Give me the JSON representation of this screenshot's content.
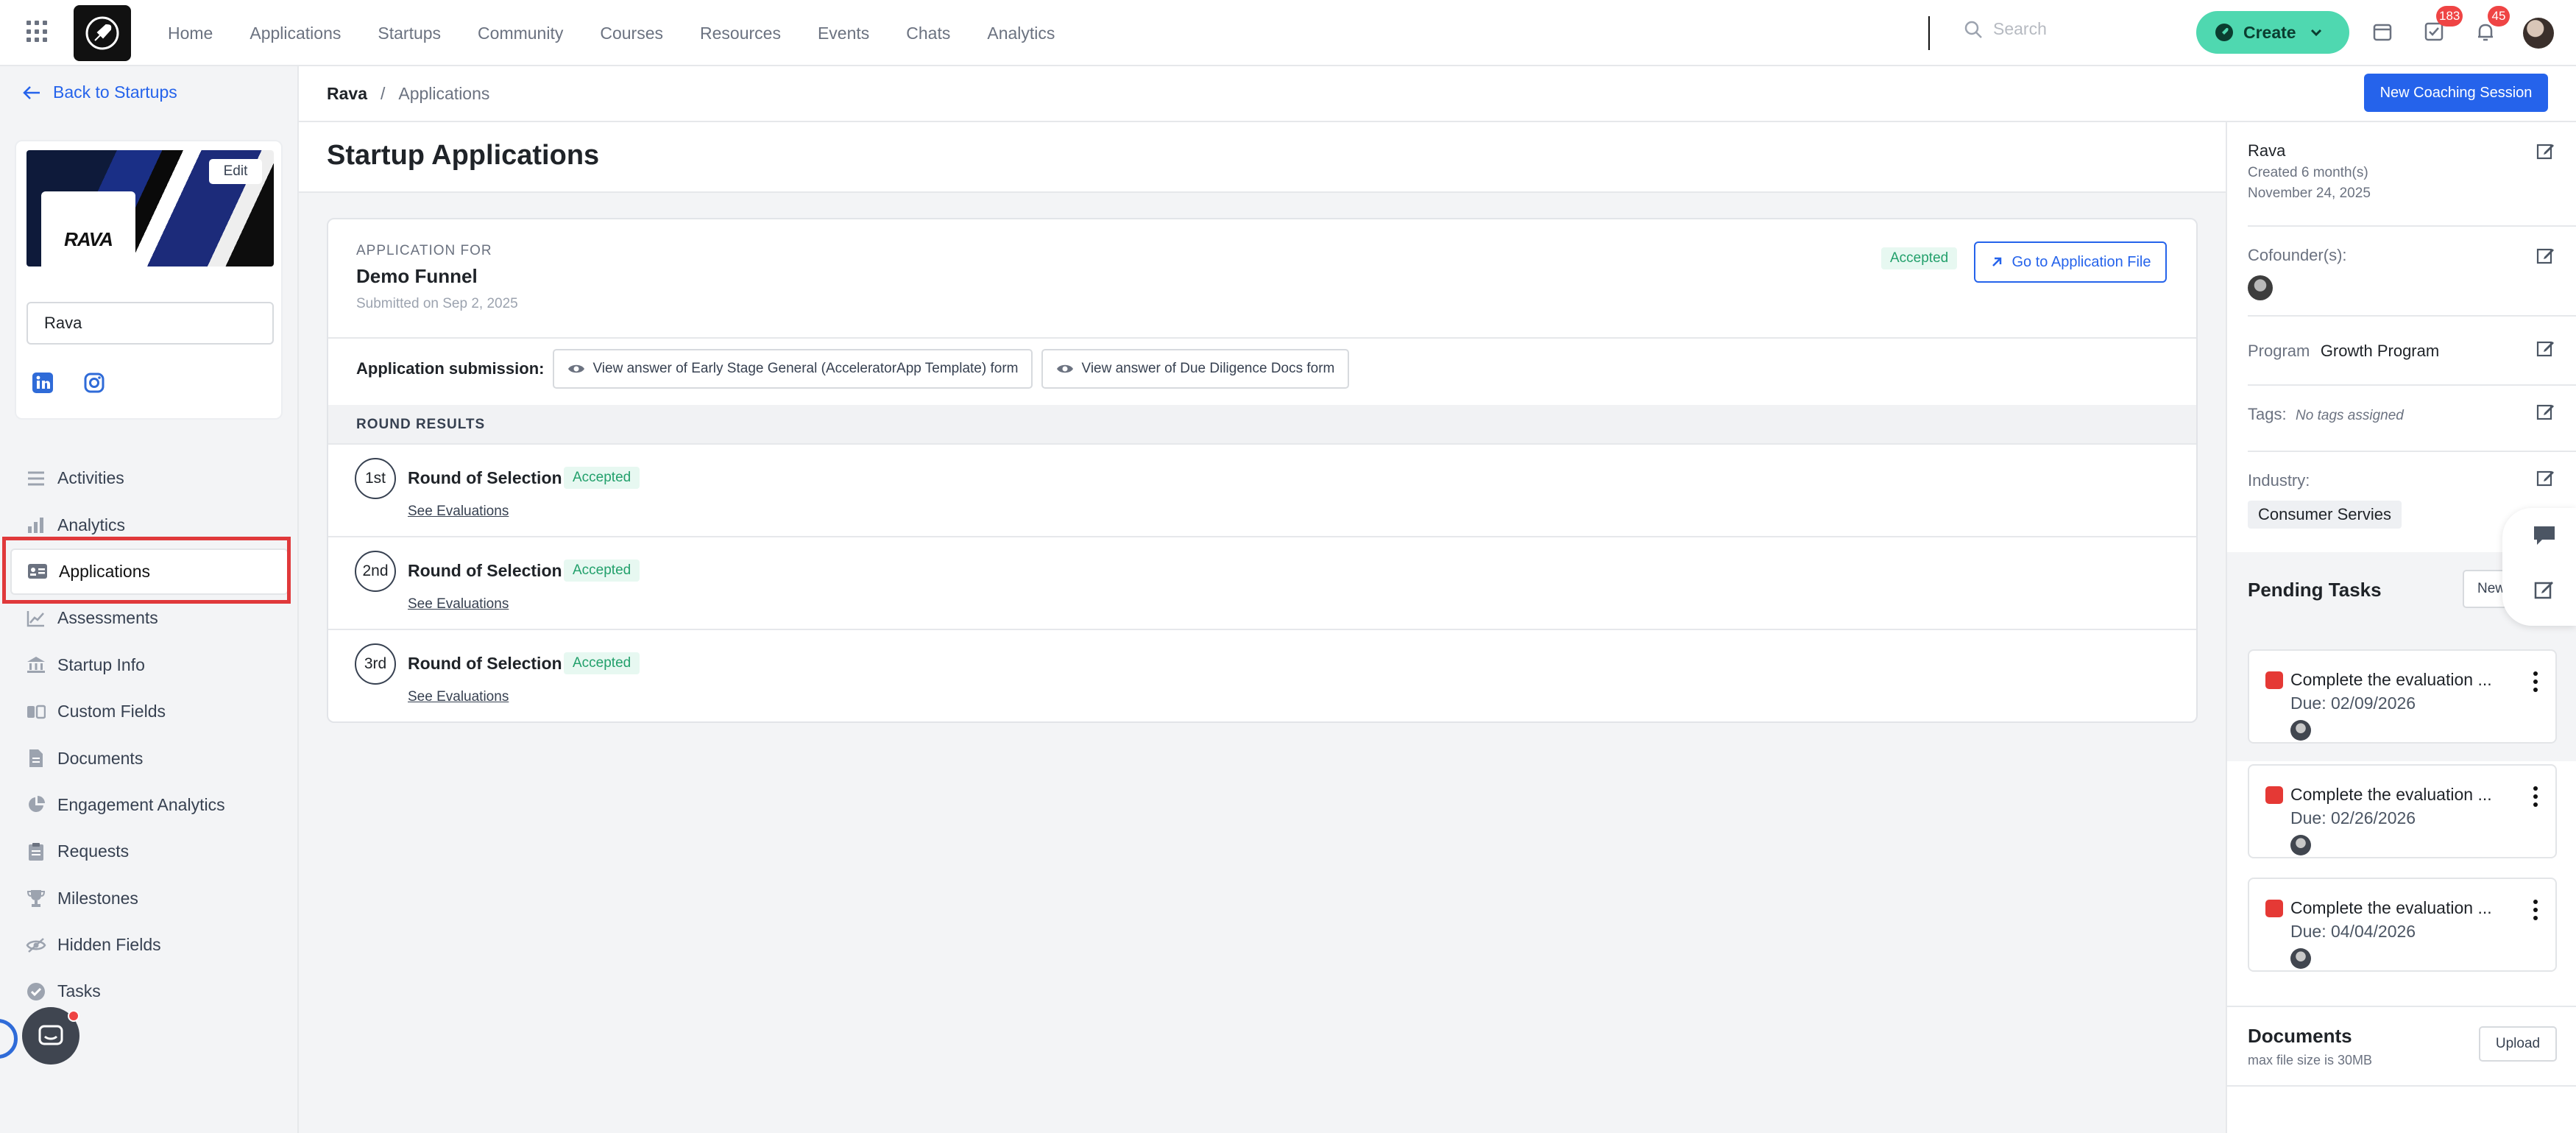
{
  "nav": {
    "links": [
      "Home",
      "Applications",
      "Startups",
      "Community",
      "Courses",
      "Resources",
      "Events",
      "Chats",
      "Analytics"
    ],
    "search_placeholder": "Search",
    "create_label": "Create",
    "tasks_badge": "183",
    "notifications_badge": "45",
    "accent_color": "#4fd8b0"
  },
  "sidebar": {
    "back_label": "Back to Startups",
    "edit_label": "Edit",
    "logo_text": "RAVA",
    "startup_name": "Rava",
    "menu": [
      {
        "label": "Activities",
        "icon": "list-icon"
      },
      {
        "label": "Analytics",
        "icon": "bar-chart-icon"
      },
      {
        "label": "Applications",
        "icon": "id-card-icon"
      },
      {
        "label": "Assessments",
        "icon": "line-chart-icon"
      },
      {
        "label": "Startup Info",
        "icon": "bank-icon"
      },
      {
        "label": "Custom Fields",
        "icon": "custom-field-icon"
      },
      {
        "label": "Documents",
        "icon": "document-icon"
      },
      {
        "label": "Engagement Analytics",
        "icon": "pie-chart-icon"
      },
      {
        "label": "Requests",
        "icon": "clipboard-icon"
      },
      {
        "label": "Milestones",
        "icon": "trophy-icon"
      },
      {
        "label": "Hidden Fields",
        "icon": "eye-off-icon"
      },
      {
        "label": "Tasks",
        "icon": "check-circle-icon"
      }
    ]
  },
  "breadcrumb": {
    "root": "Rava",
    "current": "Applications"
  },
  "header": {
    "new_coaching_label": "New Coaching Session"
  },
  "main": {
    "title": "Startup Applications",
    "application": {
      "eyebrow": "APPLICATION FOR",
      "program": "Demo Funnel",
      "submitted": "Submitted on Sep 2, 2025",
      "status": "Accepted",
      "goto_label": "Go to Application File",
      "submission_label": "Application submission:",
      "forms": [
        "View answer of Early Stage General (AcceleratorApp Template) form",
        "View answer of Due Diligence Docs form"
      ]
    },
    "round_results_label": "ROUND RESULTS",
    "rounds": [
      {
        "num": "1st",
        "title": "Round of Selection",
        "status": "Accepted",
        "link": "See Evaluations"
      },
      {
        "num": "2nd",
        "title": "Round of Selection",
        "status": "Accepted",
        "link": "See Evaluations"
      },
      {
        "num": "3rd",
        "title": "Round of Selection",
        "status": "Accepted",
        "link": "See Evaluations"
      }
    ]
  },
  "rpanel": {
    "name": "Rava",
    "created": "Created 6 month(s)",
    "date": "November 24, 2025",
    "cofounders_label": "Cofounder(s):",
    "program_label": "Program",
    "program_value": "Growth Program",
    "tags_label": "Tags:",
    "tags_value": "No tags assigned",
    "industry_label": "Industry:",
    "industry_value": "Consumer Servies",
    "pending_title": "Pending Tasks",
    "new_label": "New",
    "tasks": [
      {
        "title": "Complete the evaluation ...",
        "due": "Due: 02/09/2026"
      },
      {
        "title": "Complete the evaluation ...",
        "due": "Due: 02/26/2026"
      },
      {
        "title": "Complete the evaluation ...",
        "due": "Due: 04/04/2026"
      }
    ],
    "documents_title": "Documents",
    "documents_sub": "max file size is 30MB",
    "upload_label": "Upload"
  }
}
